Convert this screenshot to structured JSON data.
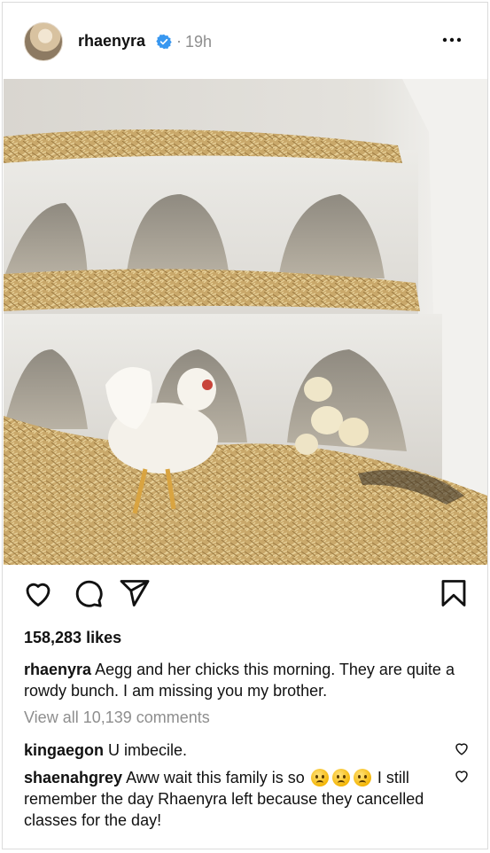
{
  "post": {
    "username": "rhaenyra",
    "separator": "·",
    "time": "19h",
    "likes": "158,283 likes",
    "caption_user": "rhaenyra",
    "caption_text": "Aegg and her chicks this morning. They are quite a rowdy bunch. I am missing you my brother.",
    "view_all": "View all 10,139 comments"
  },
  "comments": [
    {
      "user": "kingaegon",
      "text": "U imbecile."
    },
    {
      "user": "shaenahgrey",
      "text_before": "Aww wait this family is so",
      "emoji": [
        "frowning-face",
        "frowning-face",
        "frowning-face"
      ],
      "text_after": "I still remember the day Rhaenyra left because they cancelled classes for the day!"
    }
  ],
  "colors": {
    "verified": "#3897f0",
    "muted": "#8e8e8e",
    "border": "#dbdbdb"
  },
  "icons": [
    "verified-badge-icon",
    "more-options-icon",
    "heart-icon",
    "comment-icon",
    "share-icon",
    "bookmark-icon",
    "comment-like-icon"
  ]
}
